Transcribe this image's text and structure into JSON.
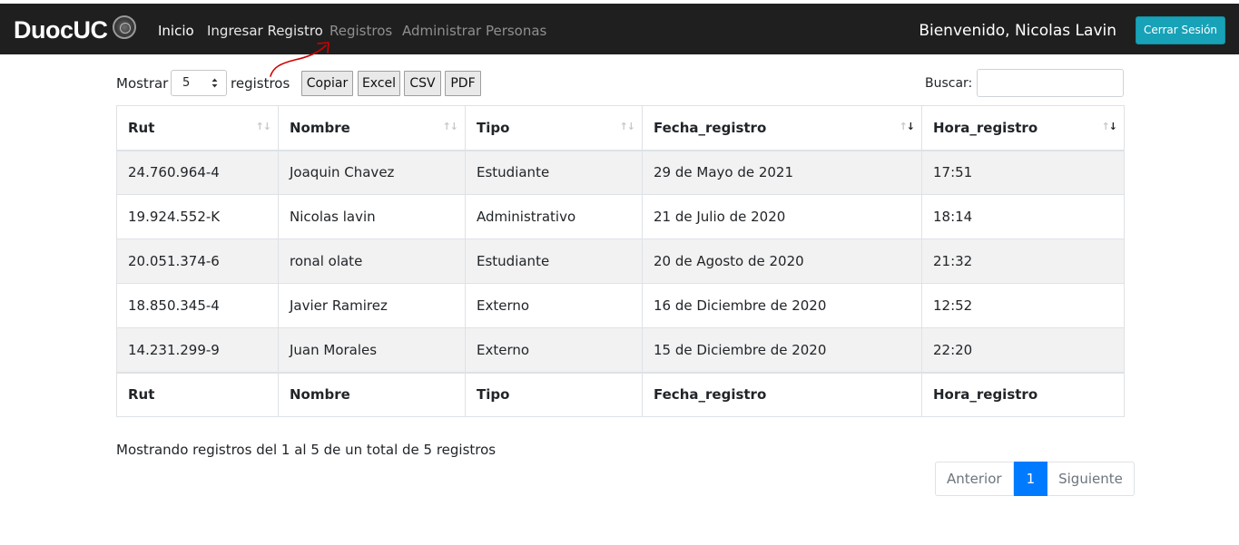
{
  "navbar": {
    "brand": "DuocUC",
    "links": [
      "Inicio",
      "Ingresar Registro",
      "Registros",
      "Administrar Personas"
    ],
    "welcome": "Bienvenido, Nicolas Lavin",
    "logout": "Cerrar Sesión"
  },
  "toolbar": {
    "show_label": "Mostrar",
    "page_length": "5",
    "records_label": "registros",
    "buttons": [
      "Copiar",
      "Excel",
      "CSV",
      "PDF"
    ],
    "search_label": "Buscar:",
    "search_value": ""
  },
  "table": {
    "columns": [
      "Rut",
      "Nombre",
      "Tipo",
      "Fecha_registro",
      "Hora_registro"
    ],
    "rows": [
      [
        "24.760.964-4",
        "Joaquin Chavez",
        "Estudiante",
        "29 de Mayo de 2021",
        "17:51"
      ],
      [
        "19.924.552-K",
        "Nicolas lavin",
        "Administrativo",
        "21 de Julio de 2020",
        "18:14"
      ],
      [
        "20.051.374-6",
        "ronal olate",
        "Estudiante",
        "20 de Agosto de 2020",
        "21:32"
      ],
      [
        "18.850.345-4",
        "Javier Ramirez",
        "Externo",
        "16 de Diciembre de 2020",
        "12:52"
      ],
      [
        "14.231.299-9",
        "Juan Morales",
        "Externo",
        "15 de Diciembre de 2020",
        "22:20"
      ]
    ]
  },
  "info": "Mostrando registros del 1 al 5 de un total de 5 registros",
  "pagination": {
    "previous": "Anterior",
    "current": "1",
    "next": "Siguiente"
  },
  "colors": {
    "navbar_bg": "#1f1f1f",
    "logout_bg": "#17a2b8",
    "active_page": "#007bff",
    "annotation": "#d10000"
  }
}
